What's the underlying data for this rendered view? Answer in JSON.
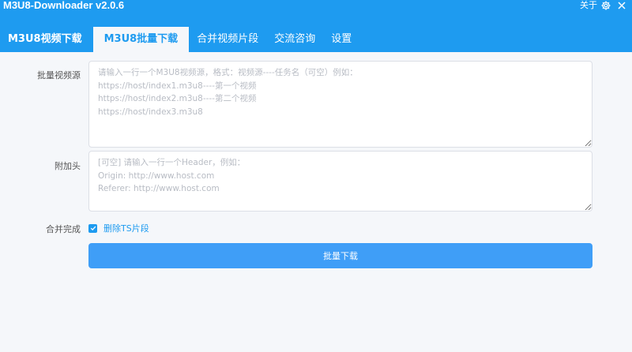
{
  "app": {
    "title": "M3U8-Downloader v2.0.6",
    "about_label": "关于",
    "colors": {
      "accent": "#1e9bf0",
      "button": "#3f9ef7",
      "background": "#f5f7fa"
    }
  },
  "tabs": [
    {
      "label": "M3U8视频下载",
      "active": false
    },
    {
      "label": "M3U8批量下载",
      "active": true
    },
    {
      "label": "合并视频片段",
      "active": false
    },
    {
      "label": "交流咨询",
      "active": false
    },
    {
      "label": "设置",
      "active": false
    }
  ],
  "form": {
    "batch_sources": {
      "label": "批量视频源",
      "value": "",
      "placeholder": "请输入一行一个M3U8视频源，格式：视频源----任务名（可空）例如：\nhttps://host/index1.m3u8----第一个视频\nhttps://host/index2.m3u8----第二个视频\nhttps://host/index3.m3u8"
    },
    "headers": {
      "label": "附加头",
      "value": "",
      "placeholder": "[可空] 请输入一行一个Header，例如：\nOrigin: http://www.host.com\nReferer: http://www.host.com"
    },
    "merge_complete": {
      "label": "合并完成",
      "checkbox_label": "删除TS片段",
      "checked": true
    },
    "submit_label": "批量下载"
  },
  "icons": {
    "settings": "gear-icon",
    "close": "close-icon",
    "checkbox": "check-icon"
  }
}
